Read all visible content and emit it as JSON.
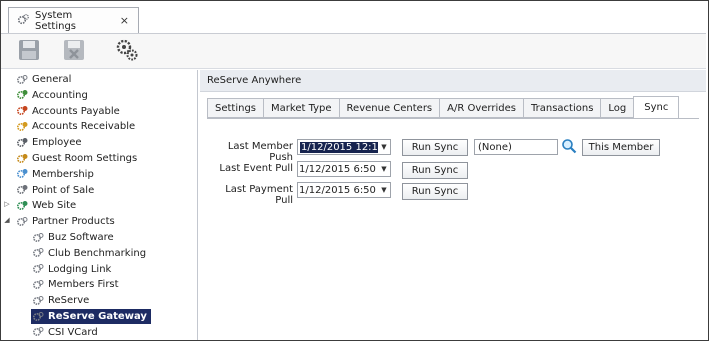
{
  "window": {
    "doc_tab": {
      "title": "System Settings",
      "close_glyph": "×"
    }
  },
  "toolbar": {
    "buttons": [
      {
        "name": "save-icon"
      },
      {
        "name": "save-close-icon"
      },
      {
        "name": "gears-icon"
      }
    ]
  },
  "tree": {
    "items": [
      {
        "label": "General",
        "icon": "gear-icon"
      },
      {
        "label": "Accounting",
        "icon": "accounting-icon"
      },
      {
        "label": "Accounts Payable",
        "icon": "accounts-payable-icon"
      },
      {
        "label": "Accounts Receivable",
        "icon": "accounts-receivable-icon"
      },
      {
        "label": "Employee",
        "icon": "employee-icon"
      },
      {
        "label": "Guest Room Settings",
        "icon": "guest-room-icon"
      },
      {
        "label": "Membership",
        "icon": "membership-icon"
      },
      {
        "label": "Point of Sale",
        "icon": "point-of-sale-icon"
      },
      {
        "label": "Web Site",
        "icon": "web-site-icon",
        "expander": "collapsed"
      },
      {
        "label": "Partner Products",
        "icon": "gear-icon",
        "expander": "expanded"
      },
      {
        "label": "Buz Software",
        "icon": "gear-icon"
      },
      {
        "label": "Club Benchmarking",
        "icon": "gear-icon"
      },
      {
        "label": "Lodging Link",
        "icon": "gear-icon"
      },
      {
        "label": "Members First",
        "icon": "gear-icon"
      },
      {
        "label": "ReServe",
        "icon": "gear-icon"
      },
      {
        "label": "ReServe Gateway",
        "icon": "gear-icon",
        "selected": true
      },
      {
        "label": "CSI VCard",
        "icon": "gear-icon"
      }
    ]
  },
  "panel": {
    "title": "ReServe Anywhere",
    "tabs": [
      "Settings",
      "Market Type",
      "Revenue Centers",
      "A/R Overrides",
      "Transactions",
      "Log",
      "Sync"
    ],
    "active_tab": "Sync"
  },
  "sync": {
    "last_member_push": {
      "label": "Last Member Push",
      "value": "1/12/2015 12:19 P",
      "button": "Run Sync"
    },
    "last_event_pull": {
      "label": "Last Event Pull",
      "value": "1/12/2015 6:50 AM",
      "button": "Run Sync"
    },
    "last_payment_pull": {
      "label": "Last Payment Pull",
      "value": "1/12/2015 6:50 AM",
      "button": "Run Sync"
    },
    "member_field": {
      "value": "(None)"
    },
    "this_member_button": "This Member"
  },
  "colors": {
    "selection": "#1d2b63",
    "frame": "#3c3c3c"
  }
}
